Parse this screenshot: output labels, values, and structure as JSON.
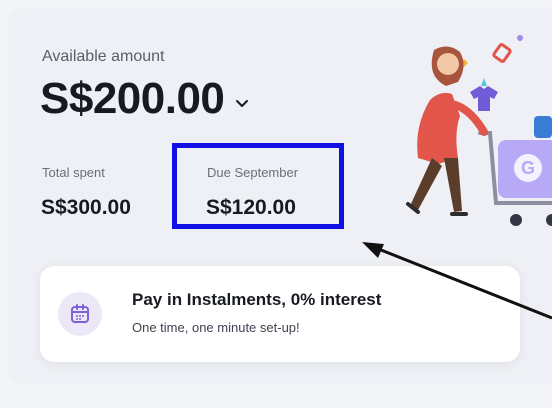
{
  "balance": {
    "available_label": "Available amount",
    "available_amount": "S$200.00",
    "total_spent_label": "Total spent",
    "total_spent_value": "S$300.00",
    "due_label": "Due September",
    "due_value": "S$120.00"
  },
  "promo_card": {
    "title": "Pay in Instalments, 0% interest",
    "subtitle": "One time, one minute set-up!",
    "icon": "calendar-icon"
  },
  "illustration": {
    "cart_logo_letter": "G"
  },
  "colors": {
    "highlight_border": "#1111e6",
    "accent_purple": "#9b8cf0",
    "woman_coat": "#e2554a"
  }
}
